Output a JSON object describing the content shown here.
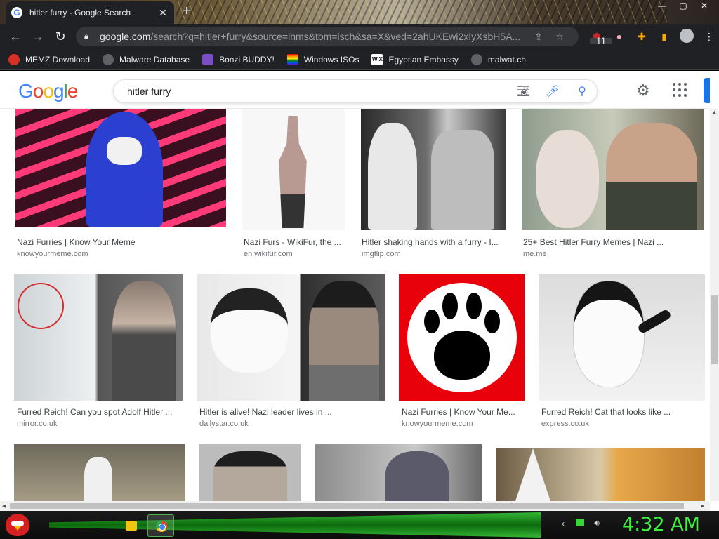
{
  "browser": {
    "tab_title": "hitler furry - Google Search",
    "tab_favicon": "G",
    "tab_close": "✕",
    "new_tab": "+",
    "url_host": "google.com",
    "url_path": "/search?q=hitler+furry&source=lnms&tbm=isch&sa=X&ved=2ahUKEwi2xIyXsbH5A...",
    "ublock_badge": "11",
    "window_controls": [
      "—",
      "▢",
      "✕"
    ]
  },
  "bookmarks": [
    {
      "label": "MEMZ Download",
      "icon": "red-circle-icon"
    },
    {
      "label": "Malware Database",
      "icon": "globe-icon"
    },
    {
      "label": "Bonzi BUDDY!",
      "icon": "bonzi-icon"
    },
    {
      "label": "Windows ISOs",
      "icon": "rainbow-flag-icon"
    },
    {
      "label": "Egyptian Embassy",
      "icon": "wix-icon",
      "icon_text": "WiX"
    },
    {
      "label": "malwat.ch",
      "icon": "globe-icon"
    }
  ],
  "google": {
    "logo": [
      "G",
      "o",
      "o",
      "g",
      "l",
      "e"
    ],
    "query": "hitler furry"
  },
  "results": [
    {
      "title": "Nazi Furries | Know Your Meme",
      "domain": "knowyourmeme.com"
    },
    {
      "title": "Nazi Furs - WikiFur, the ...",
      "domain": "en.wikifur.com"
    },
    {
      "title": "Hitler shaking hands with a furry - I...",
      "domain": "imgflip.com"
    },
    {
      "title": "25+ Best Hitler Furry Memes | Nazi ...",
      "domain": "me.me"
    },
    {
      "title": "Furred Reich! Can you spot Adolf Hitler ...",
      "domain": "mirror.co.uk"
    },
    {
      "title": "Hitler is alive! Nazi leader lives in ...",
      "domain": "dailystar.co.uk"
    },
    {
      "title": "Nazi Furries | Know Your Me...",
      "domain": "knowyourmeme.com"
    },
    {
      "title": "Furred Reich! Cat that looks like ...",
      "domain": "express.co.uk"
    }
  ],
  "taskbar": {
    "clock": "4:32 AM"
  },
  "colors": {
    "google_blue": "#4285f4",
    "chrome_dark": "#202124",
    "taskbar_green": "#3df23d"
  }
}
